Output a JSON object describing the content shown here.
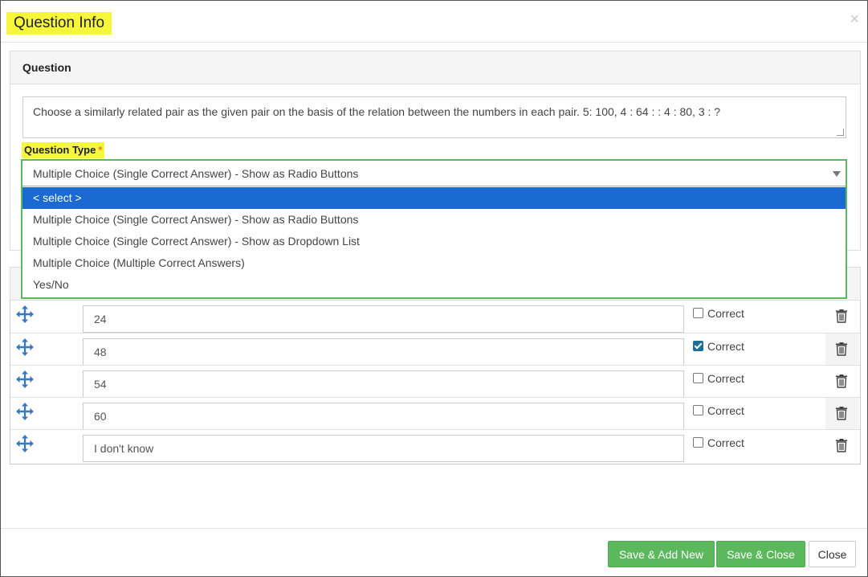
{
  "modal": {
    "title": "Question Info",
    "close_glyph": "×"
  },
  "question_panel": {
    "heading": "Question",
    "question_text": "Choose a similarly related pair as the given pair on the basis of the relation between the numbers in each pair. 5: 100, 4 : 64 : : 4 : 80, 3 : ?",
    "question_type_label": "Question Type",
    "required_marker": "*"
  },
  "question_type_select": {
    "selected_value": "Multiple Choice (Single Correct Answer) - Show as Radio Buttons",
    "options": [
      "< select >",
      "Multiple Choice (Single Correct Answer) - Show as Radio Buttons",
      "Multiple Choice (Single Correct Answer) - Show as Dropdown List",
      "Multiple Choice (Multiple Correct Answers)",
      "Yes/No"
    ],
    "highlighted_option": "< select >"
  },
  "answers": [
    {
      "value": "24",
      "correct_label": "Correct",
      "correct": false
    },
    {
      "value": "48",
      "correct_label": "Correct",
      "correct": true
    },
    {
      "value": "54",
      "correct_label": "Correct",
      "correct": false
    },
    {
      "value": "60",
      "correct_label": "Correct",
      "correct": false
    },
    {
      "value": "I don't know",
      "correct_label": "Correct",
      "correct": false
    }
  ],
  "icons": {
    "row_handle": "move-icon",
    "row_delete": "trash-icon",
    "dropdown": "chevron-down-icon"
  },
  "footer": {
    "save_add_new": "Save & Add New",
    "save_close": "Save & Close",
    "close": "Close"
  },
  "colors": {
    "title_highlight": "#f6f63a",
    "primary_green": "#5cb85c",
    "selected_option": "#1a6ad2",
    "icon_blue": "#3a79bf",
    "required_star": "#e67e22"
  }
}
